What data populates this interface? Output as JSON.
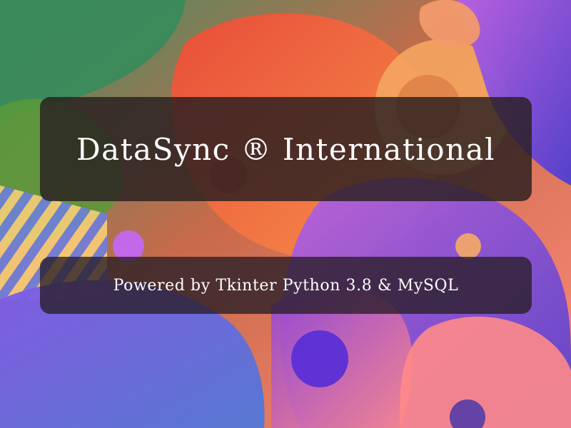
{
  "splash": {
    "title": "DataSync ® International",
    "subtitle": "Powered by Tkinter Python 3.8 & MySQL"
  },
  "colors": {
    "panel_background": "#281e20",
    "text": "#ffffff",
    "bg_green": "#3c8a5e",
    "bg_orange": "#f26a3a",
    "bg_red": "#ef3e36",
    "bg_purple": "#7a3fd0",
    "bg_violet": "#b35be0",
    "bg_pink": "#ff7a8a",
    "bg_blue": "#4b6fd6",
    "bg_peach": "#f4b27a"
  }
}
